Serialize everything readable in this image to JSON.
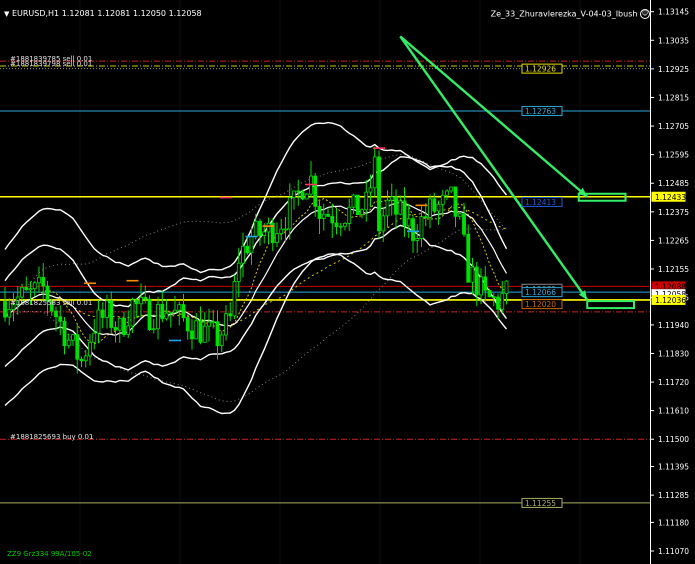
{
  "header": {
    "symbol_info": "EURUSD,H1  1.12081 1.12081 1.12050 1.12058",
    "expert_name": "Ze_33_Zhuravlerezka_V-04-03_Ibush",
    "expert_icon": "smiley-icon",
    "menu_icon": "triangle-down-icon"
  },
  "footer": {
    "indicator_label": "ZZ9 Grz334 99A/105-02"
  },
  "order_labels": [
    {
      "text": "#1881839785 sell 0.01",
      "price": 1.12955
    },
    {
      "text": "#1881839798 sell 0.01",
      "price": 1.12936
    },
    {
      "text": "#1881825583 sell 0.01",
      "price": 1.12018
    },
    {
      "text": "#1881825693 buy 0.01",
      "price": 1.115
    }
  ],
  "price_tags": [
    {
      "text": "1.12926",
      "price": 1.12926,
      "color": "#e8e000",
      "style": "outline"
    },
    {
      "text": "1.12763",
      "price": 1.12763,
      "color": "#2aa8d8",
      "style": "outline"
    },
    {
      "text": "1.12433",
      "price": 1.12433,
      "color": "#ffff00",
      "style": "filled"
    },
    {
      "text": "1.12413",
      "price": 1.12413,
      "color": "#1e5ad8",
      "style": "outline"
    },
    {
      "text": "1.12088",
      "price": 1.12088,
      "color": "#cc0000",
      "style": "filled"
    },
    {
      "text": "1.12079",
      "price": 1.12079,
      "color": "#888888",
      "style": "outline"
    },
    {
      "text": "1.12066",
      "price": 1.12066,
      "color": "#2aa8d8",
      "style": "outline"
    },
    {
      "text": "1.12058",
      "price": 1.12058,
      "color": "#ffffff",
      "style": "filled"
    },
    {
      "text": "1.12036",
      "price": 1.12036,
      "color": "#ffff00",
      "style": "filled"
    },
    {
      "text": "1.12020",
      "price": 1.1202,
      "color": "#cc6600",
      "style": "outline"
    },
    {
      "text": "1.11255",
      "price": 1.11255,
      "color": "#a8b060",
      "style": "outline"
    }
  ],
  "colors": {
    "background": "#000000",
    "candles": "#00e000",
    "bands": "#ffffff",
    "ma_dotted": "#d8c800",
    "ma_gray": "#888888",
    "step_blue": "#18a8f0",
    "step_orange": "#ff8c00",
    "arrows": "#33ee66",
    "level_yellow": "#ffff00",
    "level_red": "#cc0000",
    "level_blue": "#2aa8d8",
    "level_olive": "#a8b060"
  },
  "chart_data": {
    "type": "candlestick",
    "title": "EURUSD,H1",
    "timeframe": "H1",
    "last": {
      "open": 1.12081,
      "high": 1.12081,
      "low": 1.1205,
      "close": 1.12058
    },
    "ylim": [
      1.1102,
      1.1319
    ],
    "y_ticks": [
      "1.13145",
      "1.13035",
      "1.12925",
      "1.12815",
      "1.12705",
      "1.12595",
      "1.12485",
      "1.12375",
      "1.12265",
      "1.12155",
      "1.12045",
      "1.11940",
      "1.11830",
      "1.11720",
      "1.11610",
      "1.11500",
      "1.11395",
      "1.11285",
      "1.11180",
      "1.11070"
    ],
    "y_tick_values": [
      1.13145,
      1.13035,
      1.12925,
      1.12815,
      1.12705,
      1.12595,
      1.12485,
      1.12375,
      1.12265,
      1.12155,
      1.12045,
      1.1194,
      1.1183,
      1.1172,
      1.1161,
      1.115,
      1.11395,
      1.11285,
      1.1118,
      1.1107
    ],
    "x_range": [
      0,
      120
    ],
    "price_key": [
      [
        0,
        1.1203
      ],
      [
        5,
        1.1205
      ],
      [
        9,
        1.1208
      ],
      [
        12,
        1.1198
      ],
      [
        15,
        1.1188
      ],
      [
        18,
        1.118
      ],
      [
        21,
        1.1194
      ],
      [
        24,
        1.1198
      ],
      [
        27,
        1.1192
      ],
      [
        30,
        1.1202
      ],
      [
        34,
        1.1198
      ],
      [
        38,
        1.12
      ],
      [
        42,
        1.1196
      ],
      [
        46,
        1.1192
      ],
      [
        50,
        1.1189
      ],
      [
        53,
        1.1196
      ],
      [
        55,
        1.122
      ],
      [
        58,
        1.1228
      ],
      [
        62,
        1.123
      ],
      [
        65,
        1.1234
      ],
      [
        68,
        1.124
      ],
      [
        70,
        1.1248
      ],
      [
        72,
        1.125
      ],
      [
        74,
        1.1238
      ],
      [
        78,
        1.1236
      ],
      [
        82,
        1.1238
      ],
      [
        85,
        1.124
      ],
      [
        87,
        1.1255
      ],
      [
        88,
        1.1232
      ],
      [
        90,
        1.124
      ],
      [
        93,
        1.1236
      ],
      [
        96,
        1.123
      ],
      [
        100,
        1.1238
      ],
      [
        103,
        1.124
      ],
      [
        105,
        1.1242
      ],
      [
        107,
        1.1232
      ],
      [
        109,
        1.1215
      ],
      [
        111,
        1.121
      ],
      [
        113,
        1.1204
      ],
      [
        116,
        1.1203
      ],
      [
        118,
        1.1206
      ]
    ],
    "horizontal_levels": [
      {
        "price": 1.12955,
        "color": "#cc2222",
        "dash": "dashdot"
      },
      {
        "price": 1.12936,
        "color": "#c8c800",
        "dash": "dashdot"
      },
      {
        "price": 1.12926,
        "color": "#a0a030",
        "dash": "dot"
      },
      {
        "price": 1.12763,
        "color": "#2aa8d8",
        "dash": "solid"
      },
      {
        "price": 1.12433,
        "color": "#ffff00",
        "dash": "solid"
      },
      {
        "price": 1.12088,
        "color": "#cc0000",
        "dash": "solid"
      },
      {
        "price": 1.12066,
        "color": "#2aa8d8",
        "dash": "solid"
      },
      {
        "price": 1.12036,
        "color": "#ffff00",
        "dash": "solid"
      },
      {
        "price": 1.1199,
        "color": "#cc2222",
        "dash": "dashdot"
      },
      {
        "price": 1.115,
        "color": "#cc2222",
        "dash": "dashdot"
      },
      {
        "price": 1.11255,
        "color": "#a8b060",
        "dash": "solid"
      }
    ],
    "arrows": [
      {
        "from": [
          93,
          1.1305
        ],
        "to": [
          137,
          1.12433
        ]
      },
      {
        "from": [
          93,
          1.1305
        ],
        "to": [
          137,
          1.12036
        ]
      }
    ],
    "arrow_boxes": [
      {
        "price": 1.12433,
        "x0": 135,
        "x1": 146
      },
      {
        "price": 1.1202,
        "x0": 137,
        "x1": 148
      }
    ]
  }
}
